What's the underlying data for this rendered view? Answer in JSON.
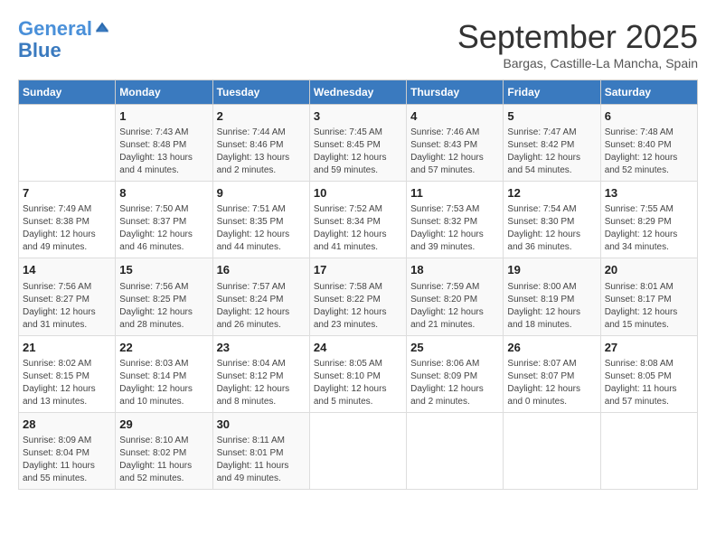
{
  "header": {
    "logo_line1": "General",
    "logo_line2": "Blue",
    "month": "September 2025",
    "location": "Bargas, Castille-La Mancha, Spain"
  },
  "days_of_week": [
    "Sunday",
    "Monday",
    "Tuesday",
    "Wednesday",
    "Thursday",
    "Friday",
    "Saturday"
  ],
  "weeks": [
    [
      {
        "day": "",
        "info": ""
      },
      {
        "day": "1",
        "info": "Sunrise: 7:43 AM\nSunset: 8:48 PM\nDaylight: 13 hours\nand 4 minutes."
      },
      {
        "day": "2",
        "info": "Sunrise: 7:44 AM\nSunset: 8:46 PM\nDaylight: 13 hours\nand 2 minutes."
      },
      {
        "day": "3",
        "info": "Sunrise: 7:45 AM\nSunset: 8:45 PM\nDaylight: 12 hours\nand 59 minutes."
      },
      {
        "day": "4",
        "info": "Sunrise: 7:46 AM\nSunset: 8:43 PM\nDaylight: 12 hours\nand 57 minutes."
      },
      {
        "day": "5",
        "info": "Sunrise: 7:47 AM\nSunset: 8:42 PM\nDaylight: 12 hours\nand 54 minutes."
      },
      {
        "day": "6",
        "info": "Sunrise: 7:48 AM\nSunset: 8:40 PM\nDaylight: 12 hours\nand 52 minutes."
      }
    ],
    [
      {
        "day": "7",
        "info": "Sunrise: 7:49 AM\nSunset: 8:38 PM\nDaylight: 12 hours\nand 49 minutes."
      },
      {
        "day": "8",
        "info": "Sunrise: 7:50 AM\nSunset: 8:37 PM\nDaylight: 12 hours\nand 46 minutes."
      },
      {
        "day": "9",
        "info": "Sunrise: 7:51 AM\nSunset: 8:35 PM\nDaylight: 12 hours\nand 44 minutes."
      },
      {
        "day": "10",
        "info": "Sunrise: 7:52 AM\nSunset: 8:34 PM\nDaylight: 12 hours\nand 41 minutes."
      },
      {
        "day": "11",
        "info": "Sunrise: 7:53 AM\nSunset: 8:32 PM\nDaylight: 12 hours\nand 39 minutes."
      },
      {
        "day": "12",
        "info": "Sunrise: 7:54 AM\nSunset: 8:30 PM\nDaylight: 12 hours\nand 36 minutes."
      },
      {
        "day": "13",
        "info": "Sunrise: 7:55 AM\nSunset: 8:29 PM\nDaylight: 12 hours\nand 34 minutes."
      }
    ],
    [
      {
        "day": "14",
        "info": "Sunrise: 7:56 AM\nSunset: 8:27 PM\nDaylight: 12 hours\nand 31 minutes."
      },
      {
        "day": "15",
        "info": "Sunrise: 7:56 AM\nSunset: 8:25 PM\nDaylight: 12 hours\nand 28 minutes."
      },
      {
        "day": "16",
        "info": "Sunrise: 7:57 AM\nSunset: 8:24 PM\nDaylight: 12 hours\nand 26 minutes."
      },
      {
        "day": "17",
        "info": "Sunrise: 7:58 AM\nSunset: 8:22 PM\nDaylight: 12 hours\nand 23 minutes."
      },
      {
        "day": "18",
        "info": "Sunrise: 7:59 AM\nSunset: 8:20 PM\nDaylight: 12 hours\nand 21 minutes."
      },
      {
        "day": "19",
        "info": "Sunrise: 8:00 AM\nSunset: 8:19 PM\nDaylight: 12 hours\nand 18 minutes."
      },
      {
        "day": "20",
        "info": "Sunrise: 8:01 AM\nSunset: 8:17 PM\nDaylight: 12 hours\nand 15 minutes."
      }
    ],
    [
      {
        "day": "21",
        "info": "Sunrise: 8:02 AM\nSunset: 8:15 PM\nDaylight: 12 hours\nand 13 minutes."
      },
      {
        "day": "22",
        "info": "Sunrise: 8:03 AM\nSunset: 8:14 PM\nDaylight: 12 hours\nand 10 minutes."
      },
      {
        "day": "23",
        "info": "Sunrise: 8:04 AM\nSunset: 8:12 PM\nDaylight: 12 hours\nand 8 minutes."
      },
      {
        "day": "24",
        "info": "Sunrise: 8:05 AM\nSunset: 8:10 PM\nDaylight: 12 hours\nand 5 minutes."
      },
      {
        "day": "25",
        "info": "Sunrise: 8:06 AM\nSunset: 8:09 PM\nDaylight: 12 hours\nand 2 minutes."
      },
      {
        "day": "26",
        "info": "Sunrise: 8:07 AM\nSunset: 8:07 PM\nDaylight: 12 hours\nand 0 minutes."
      },
      {
        "day": "27",
        "info": "Sunrise: 8:08 AM\nSunset: 8:05 PM\nDaylight: 11 hours\nand 57 minutes."
      }
    ],
    [
      {
        "day": "28",
        "info": "Sunrise: 8:09 AM\nSunset: 8:04 PM\nDaylight: 11 hours\nand 55 minutes."
      },
      {
        "day": "29",
        "info": "Sunrise: 8:10 AM\nSunset: 8:02 PM\nDaylight: 11 hours\nand 52 minutes."
      },
      {
        "day": "30",
        "info": "Sunrise: 8:11 AM\nSunset: 8:01 PM\nDaylight: 11 hours\nand 49 minutes."
      },
      {
        "day": "",
        "info": ""
      },
      {
        "day": "",
        "info": ""
      },
      {
        "day": "",
        "info": ""
      },
      {
        "day": "",
        "info": ""
      }
    ]
  ]
}
